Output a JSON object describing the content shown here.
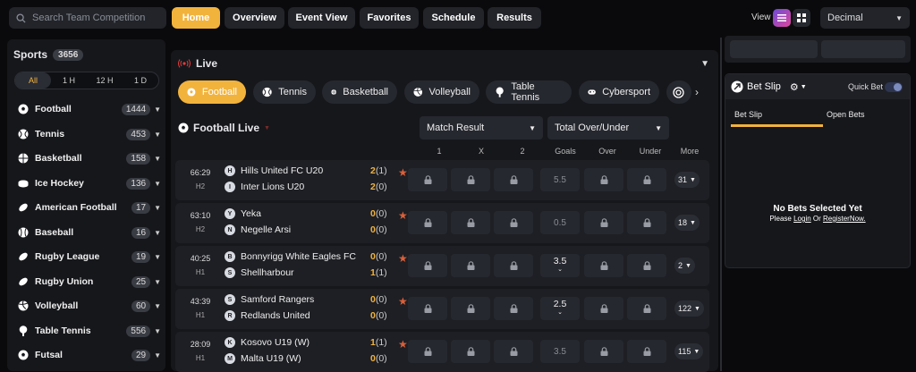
{
  "search": {
    "placeholder": "Search Team Competition"
  },
  "nav": {
    "home": "Home",
    "overview": "Overview",
    "event_view": "Event View",
    "favorites": "Favorites",
    "schedule": "Schedule",
    "results": "Results"
  },
  "view": {
    "label": "View",
    "odds_format": "Decimal"
  },
  "sidebar": {
    "title": "Sports",
    "total": "3656",
    "filters": [
      "All",
      "1 H",
      "12 H",
      "1 D"
    ],
    "items": [
      {
        "label": "Football",
        "count": "1444"
      },
      {
        "label": "Tennis",
        "count": "453"
      },
      {
        "label": "Basketball",
        "count": "158"
      },
      {
        "label": "Ice Hockey",
        "count": "136"
      },
      {
        "label": "American Football",
        "count": "17"
      },
      {
        "label": "Baseball",
        "count": "16"
      },
      {
        "label": "Rugby League",
        "count": "19"
      },
      {
        "label": "Rugby Union",
        "count": "25"
      },
      {
        "label": "Volleyball",
        "count": "60"
      },
      {
        "label": "Table Tennis",
        "count": "556"
      },
      {
        "label": "Futsal",
        "count": "29"
      }
    ]
  },
  "live": {
    "title": "Live",
    "tabs": [
      "Football",
      "Tennis",
      "Basketball",
      "Volleyball",
      "Table Tennis",
      "Cybersport"
    ],
    "section_title": "Football Live",
    "market1": "Match Result",
    "market2": "Total Over/Under",
    "columns": [
      "1",
      "X",
      "2",
      "Goals",
      "Over",
      "Under",
      "More"
    ],
    "matches": [
      {
        "time": "66:29",
        "half": "H2",
        "home": "Hills United FC U20",
        "away": "Inter Lions U20",
        "home_score": "2",
        "home_ht": "(1)",
        "away_score": "2",
        "away_ht": "(0)",
        "goals": "5.5",
        "more": "31"
      },
      {
        "time": "63:10",
        "half": "H2",
        "home": "Yeka",
        "away": "Negelle Arsi",
        "home_score": "0",
        "home_ht": "(0)",
        "away_score": "0",
        "away_ht": "(0)",
        "goals": "0.5",
        "more": "18"
      },
      {
        "time": "40:25",
        "half": "H1",
        "home": "Bonnyrigg White Eagles FC",
        "away": "Shellharbour",
        "home_score": "0",
        "home_ht": "(0)",
        "away_score": "1",
        "away_ht": "(1)",
        "goals": "3.5",
        "more": "2"
      },
      {
        "time": "43:39",
        "half": "H1",
        "home": "Samford Rangers",
        "away": "Redlands United",
        "home_score": "0",
        "home_ht": "(0)",
        "away_score": "0",
        "away_ht": "(0)",
        "goals": "2.5",
        "more": "122"
      },
      {
        "time": "28:09",
        "half": "H1",
        "home": "Kosovo U19 (W)",
        "away": "Malta U19 (W)",
        "home_score": "1",
        "home_ht": "(1)",
        "away_score": "0",
        "away_ht": "(0)",
        "goals": "3.5",
        "more": "115"
      }
    ]
  },
  "betslip": {
    "title": "Bet Slip",
    "quick_bet": "Quick Bet",
    "tab1": "Bet Slip",
    "tab2": "Open Bets",
    "empty": "No Bets Selected Yet",
    "please": "Please",
    "login": "Login",
    "or": "Or",
    "register": "RegisterNow."
  },
  "colors": {
    "accent": "#f2b33d",
    "panel": "#16171b",
    "cell": "#26282f",
    "star": "#d9603a"
  }
}
